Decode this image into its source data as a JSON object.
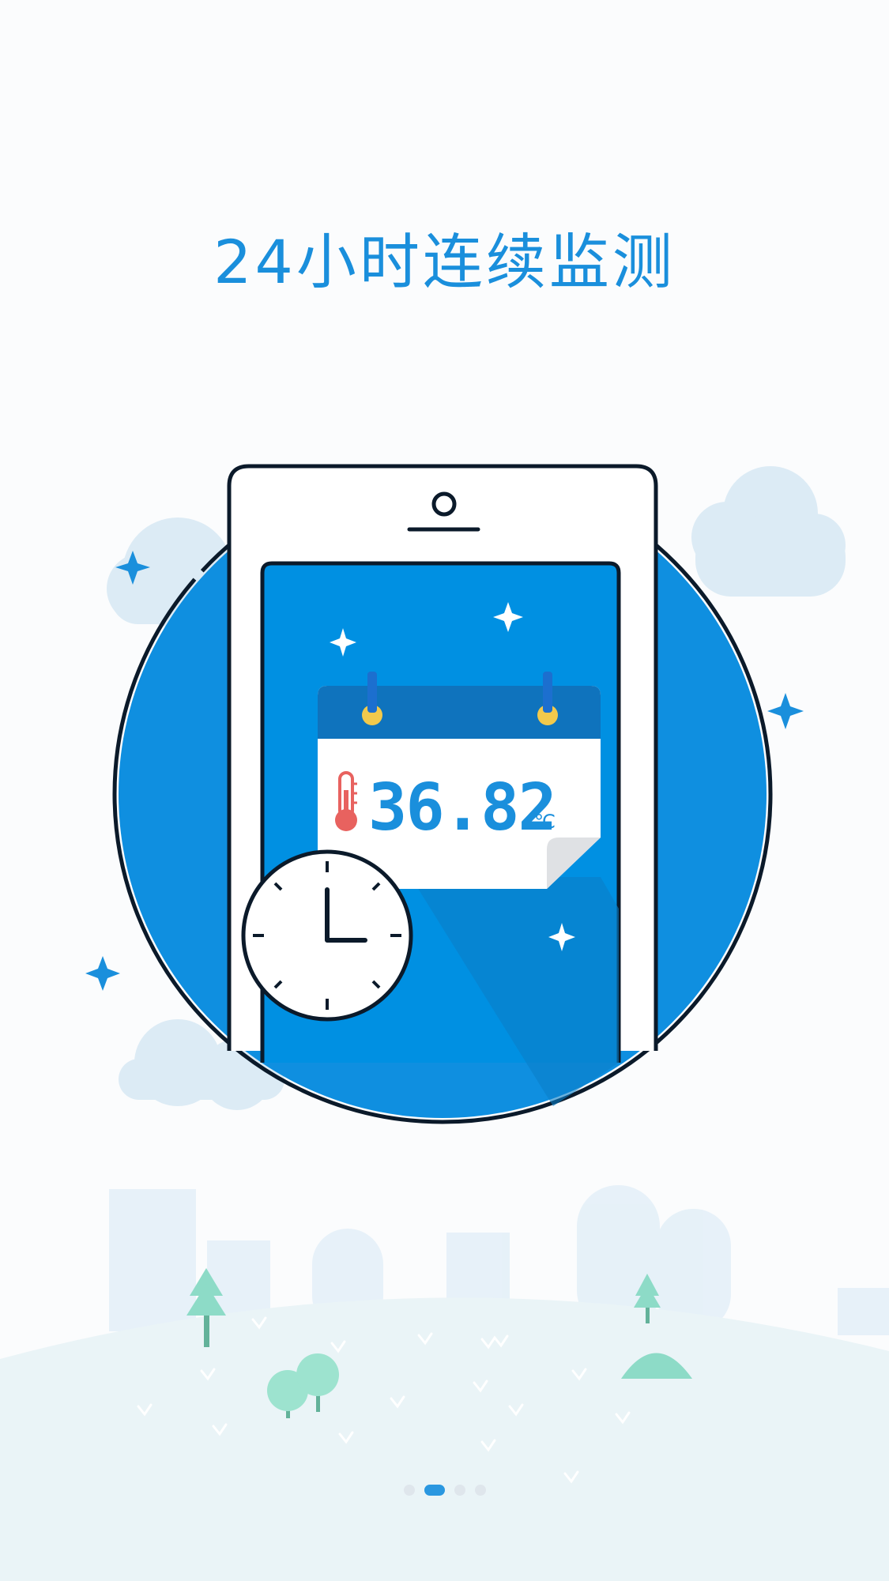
{
  "headline": "24小时连续监测",
  "reading": {
    "value": "36.82",
    "unit": "℃"
  },
  "icons": [
    "phone-icon",
    "calendar-icon",
    "thermometer-icon",
    "clock-icon",
    "sparkle-icon",
    "cloud-icon",
    "tree-icon"
  ],
  "colors": {
    "accent": "#1a8fdc",
    "circle": "#0f8fe0",
    "screen": "#0090e2",
    "thermometer": "#e8625f",
    "ring_gold": "#f2c94c"
  },
  "pager": {
    "count": 4,
    "active_index": 1
  }
}
